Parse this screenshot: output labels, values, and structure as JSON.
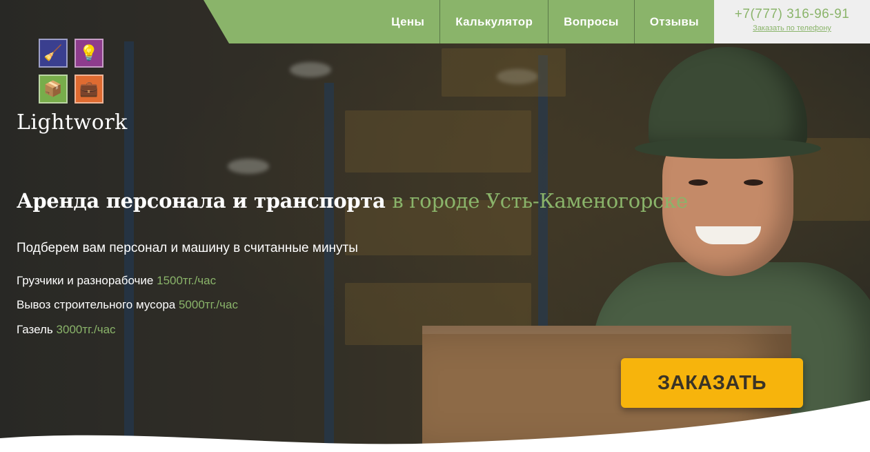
{
  "nav": {
    "items": [
      {
        "label": "Цены"
      },
      {
        "label": "Калькулятор"
      },
      {
        "label": "Вопросы"
      },
      {
        "label": "Отзывы"
      }
    ]
  },
  "contact": {
    "phone": "+7(777) 316-96-91",
    "callback_link": "Заказать по телефону"
  },
  "logo": {
    "text": "Lightwork",
    "icons": [
      "cleaner-icon",
      "lightbulb-icon",
      "mover-icon",
      "office-worker-icon"
    ]
  },
  "hero": {
    "headline_main": "Аренда персонала и транспорта",
    "headline_city": "в городе Усть-Каменогорске",
    "subtitle": "Подберем вам персонал и машину в считанные минуты",
    "prices": [
      {
        "label": "Грузчики и разнорабочие",
        "value": "1500тг./час"
      },
      {
        "label": "Вывоз строительного мусора",
        "value": "5000тг./час"
      },
      {
        "label": "Газель",
        "value": "3000тг./час"
      }
    ],
    "order_button": "ЗАКАЗАТЬ"
  },
  "colors": {
    "accent_green": "#8ab46a",
    "button_yellow": "#f7b40c"
  }
}
